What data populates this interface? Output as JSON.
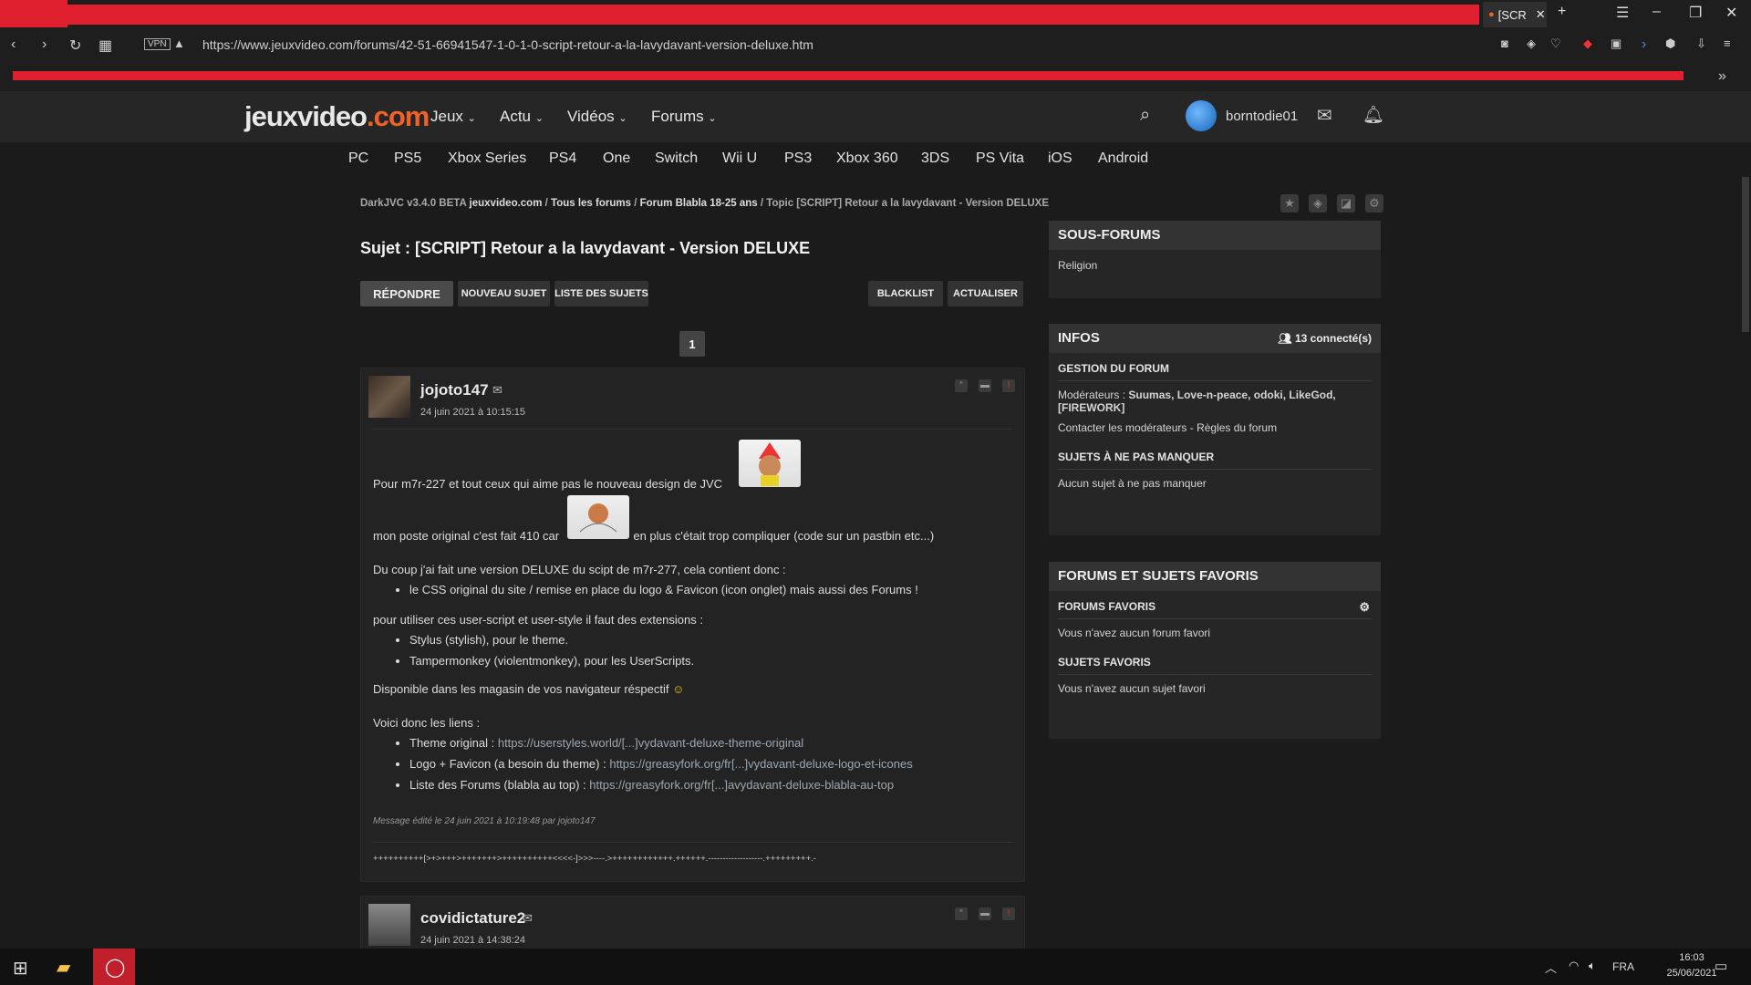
{
  "browser": {
    "tab_label": "[SCR",
    "url": "https://www.jeuxvideo.com/forums/42-51-66941547-1-0-1-0-script-retour-a-la-lavydavant-version-deluxe.htm",
    "vpn_label": "VPN"
  },
  "site": {
    "logo_main": "jeuxvideo",
    "logo_tld": ".com",
    "nav": [
      "Jeux",
      "Actu",
      "Vidéos",
      "Forums"
    ],
    "username": "borntodie01",
    "platforms": [
      "PC",
      "PS5",
      "Xbox Series",
      "PS4",
      "One",
      "Switch",
      "Wii U",
      "PS3",
      "Xbox 360",
      "3DS",
      "PS Vita",
      "iOS",
      "Android"
    ]
  },
  "breadcrumb": {
    "prefix": "DarkJVC v3.4.0 BETA",
    "site": "jeuxvideo.com",
    "items": [
      "Tous les forums",
      "Forum Blabla 18-25 ans",
      "Topic [SCRIPT] Retour a la lavydavant - Version DELUXE"
    ]
  },
  "topic": {
    "title": "Sujet : [SCRIPT] Retour a la lavydavant - Version DELUXE",
    "buttons": {
      "reply": "RÉPONDRE",
      "new": "NOUVEAU SUJET",
      "list": "LISTE DES SUJETS",
      "blacklist": "BLACKLIST",
      "refresh": "ACTUALISER"
    },
    "page": "1"
  },
  "posts": [
    {
      "author": "jojoto147",
      "date": "24 juin 2021 à 10:15:15",
      "line1": "Pour m7r-227 et tout ceux qui aime pas le nouveau design de JVC",
      "line2a": "mon poste original c'est fait 410 car",
      "line2b": "en plus c'était trop compliquer (code sur un pastbin etc...)",
      "line3": "Du coup j'ai fait une version DELUXE du scipt de m7r-277, cela contient donc :",
      "list1": [
        "le CSS original du site / remise en place du logo & Favicon (icon onglet) mais aussi des Forums !"
      ],
      "line4": "pour utiliser ces user-script et user-style il faut des extensions :",
      "list2": [
        "Stylus (stylish), pour le theme.",
        "Tampermonkey (violentmonkey), pour les UserScripts."
      ],
      "line5": "Disponible dans les magasin de vos navigateur réspectif",
      "line6": "Voici donc les liens :",
      "links": [
        {
          "label": "Theme original",
          "url": "https://userstyles.world/[...]vydavant-deluxe-theme-original"
        },
        {
          "label": "Logo + Favicon (a besoin du theme)",
          "url": "https://greasyfork.org/fr[...]vydavant-deluxe-logo-et-icones"
        },
        {
          "label": "Liste des Forums (blabla au top)",
          "url": "https://greasyfork.org/fr[...]avydavant-deluxe-blabla-au-top"
        }
      ],
      "edited": "Message édité le 24 juin 2021 à 10:19:48 par jojoto147",
      "signature": "++++++++++[>+>+++>+++++++>++++++++++<<<<-]>>>----.>++++++++++++.++++++.-------------------.+++++++++.-"
    },
    {
      "author": "covidictature2",
      "date": "24 juin 2021 à 14:38:24"
    }
  ],
  "sidebar": {
    "sous_forums_title": "SOUS-FORUMS",
    "sous_forums": [
      "Religion"
    ],
    "infos_title": "INFOS",
    "connected": "13 connecté(s)",
    "gestion_title": "GESTION DU FORUM",
    "moderators_label": "Modérateurs :",
    "moderators": "Suumas, Love-n-peace, odoki, LikeGod, [FIREWORK]",
    "contact_line": "Contacter les modérateurs - Règles du forum",
    "must_read_title": "SUJETS À NE PAS MANQUER",
    "must_read_text": "Aucun sujet à ne pas manquer",
    "fav_title": "FORUMS ET SUJETS FAVORIS",
    "fav_forums_title": "FORUMS FAVORIS",
    "fav_forums_text": "Vous n'avez aucun forum favori",
    "fav_topics_title": "SUJETS FAVORIS",
    "fav_topics_text": "Vous n'avez aucun sujet favori"
  },
  "taskbar": {
    "lang": "FRA",
    "time": "16:03",
    "date": "25/06/2021"
  },
  "colors": {
    "accent": "#e0202e",
    "logo_tld": "#f0612a",
    "link": "#9aa7b3"
  }
}
